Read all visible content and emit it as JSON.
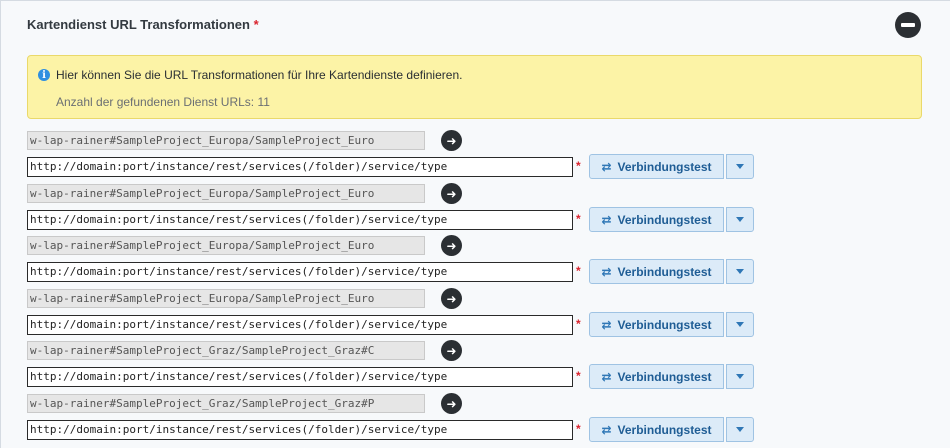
{
  "section": {
    "title": "Kartendienst URL Transformationen",
    "required_mark": "*"
  },
  "info": {
    "icon": "info-icon",
    "message": "Hier können Sie die URL Transformationen für Ihre Kartendienste definieren.",
    "count_text": "Anzahl der gefundenen Dienst URLs: 11"
  },
  "rows": [
    {
      "source": "w-lap-rainer#SampleProject_Europa/SampleProject_Euro",
      "url": "http://domain:port/instance/rest/services(/folder)/service/type"
    },
    {
      "source": "w-lap-rainer#SampleProject_Europa/SampleProject_Euro",
      "url": "http://domain:port/instance/rest/services(/folder)/service/type"
    },
    {
      "source": "w-lap-rainer#SampleProject_Europa/SampleProject_Euro",
      "url": "http://domain:port/instance/rest/services(/folder)/service/type"
    },
    {
      "source": "w-lap-rainer#SampleProject_Europa/SampleProject_Euro",
      "url": "http://domain:port/instance/rest/services(/folder)/service/type"
    },
    {
      "source": "w-lap-rainer#SampleProject_Graz/SampleProject_Graz#C",
      "url": "http://domain:port/instance/rest/services(/folder)/service/type"
    },
    {
      "source": "w-lap-rainer#SampleProject_Graz/SampleProject_Graz#P",
      "url": "http://domain:port/instance/rest/services(/folder)/service/type"
    }
  ],
  "row_labels": {
    "required_mark": "*",
    "test_button": "Verbindungstest",
    "test_icon": "swap-arrows-icon",
    "arrow_icon": "arrow-right-icon",
    "dropdown_icon": "caret-down-icon"
  },
  "colors": {
    "info_bg": "#fcf3a6",
    "button_bg": "#dcebf8",
    "button_text": "#1f5d95",
    "required": "#d9232d"
  }
}
